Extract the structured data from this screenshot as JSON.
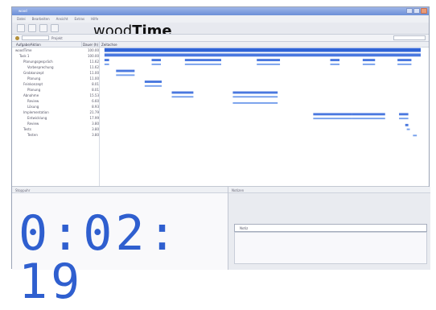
{
  "window": {
    "title": "wood",
    "menus": [
      "Datei",
      "Bearbeiten",
      "Ansicht",
      "Extras",
      "Hilfe"
    ]
  },
  "brand": {
    "prefix": "wood",
    "suffix": "Time"
  },
  "filter": {
    "label": "Projekt"
  },
  "gantt": {
    "headers": {
      "name": "Aufgabe/Aktion",
      "duration": "Dauer (h)",
      "timeline": "Zeitachse"
    },
    "rows": [
      {
        "name": "woodTime",
        "duration": "100.00",
        "level": 0
      },
      {
        "name": "Task 1",
        "duration": "100.00",
        "level": 1
      },
      {
        "name": "Planungsgespräch",
        "duration": "11.62",
        "level": 2
      },
      {
        "name": "Vorbesprechung",
        "duration": "11.62",
        "level": 3
      },
      {
        "name": "Grobkonzept",
        "duration": "11.00",
        "level": 2
      },
      {
        "name": "Planung",
        "duration": "11.00",
        "level": 3
      },
      {
        "name": "Feinkonzept",
        "duration": "8.01",
        "level": 2
      },
      {
        "name": "Planung",
        "duration": "8.01",
        "level": 3
      },
      {
        "name": "Abnahme",
        "duration": "15.53",
        "level": 2
      },
      {
        "name": "Review",
        "duration": "6.60",
        "level": 3
      },
      {
        "name": "Lösung",
        "duration": "8.93",
        "level": 3
      },
      {
        "name": "Implementation",
        "duration": "21.79",
        "level": 2
      },
      {
        "name": "Entwicklung",
        "duration": "17.99",
        "level": 3
      },
      {
        "name": "Review",
        "duration": "3.80",
        "level": 3
      },
      {
        "name": "Tests",
        "duration": "3.80",
        "level": 2
      },
      {
        "name": "Testen",
        "duration": "3.80",
        "level": 3
      }
    ]
  },
  "panels": {
    "left_title": "Stoppuhr",
    "right_title": "Notizen"
  },
  "clock": {
    "value": "0:02: 19"
  },
  "notes": {
    "entry": "Notiz"
  }
}
